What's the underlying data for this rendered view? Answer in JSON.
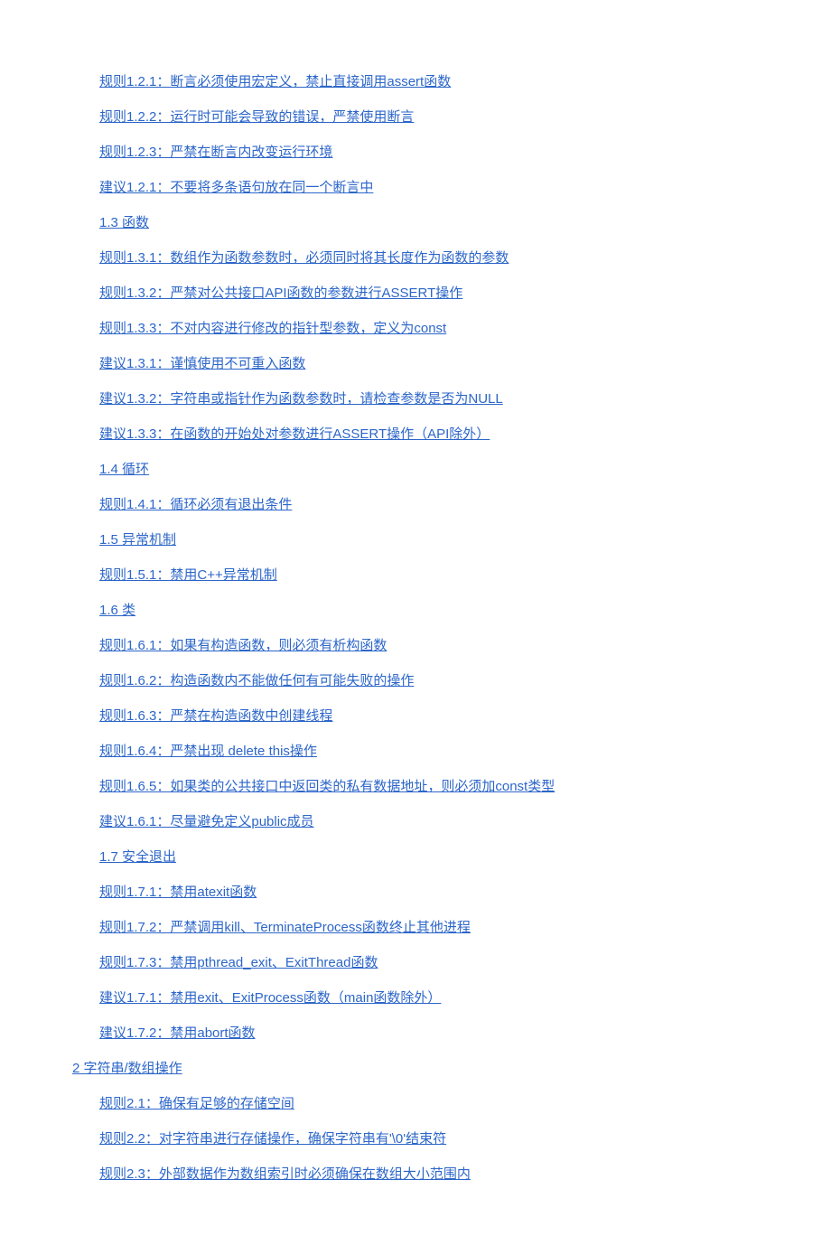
{
  "toc": [
    {
      "level": 3,
      "text": "规则1.2.1：断言必须使用宏定义，禁止直接调用assert函数"
    },
    {
      "level": 3,
      "text": "规则1.2.2：运行时可能会导致的错误，严禁使用断言"
    },
    {
      "level": 3,
      "text": "规则1.2.3：严禁在断言内改变运行环境"
    },
    {
      "level": 3,
      "text": "建议1.2.1：不要将多条语句放在同一个断言中"
    },
    {
      "level": 2,
      "text": "1.3 函数"
    },
    {
      "level": 3,
      "text": "规则1.3.1：数组作为函数参数时，必须同时将其长度作为函数的参数"
    },
    {
      "level": 3,
      "text": "规则1.3.2：严禁对公共接口API函数的参数进行ASSERT操作"
    },
    {
      "level": 3,
      "text": "规则1.3.3：不对内容进行修改的指针型参数，定义为const"
    },
    {
      "level": 3,
      "text": "建议1.3.1：谨慎使用不可重入函数"
    },
    {
      "level": 3,
      "text": "建议1.3.2：字符串或指针作为函数参数时，请检查参数是否为NULL"
    },
    {
      "level": 3,
      "text": "建议1.3.3：在函数的开始处对参数进行ASSERT操作（API除外）"
    },
    {
      "level": 2,
      "text": "1.4 循环"
    },
    {
      "level": 3,
      "text": "规则1.4.1：循环必须有退出条件"
    },
    {
      "level": 2,
      "text": "1.5 异常机制"
    },
    {
      "level": 3,
      "text": "规则1.5.1：禁用C++异常机制"
    },
    {
      "level": 2,
      "text": "1.6 类"
    },
    {
      "level": 3,
      "text": "规则1.6.1：如果有构造函数，则必须有析构函数"
    },
    {
      "level": 3,
      "text": "规则1.6.2：构造函数内不能做任何有可能失败的操作"
    },
    {
      "level": 3,
      "text": "规则1.6.3：严禁在构造函数中创建线程"
    },
    {
      "level": 3,
      "text": "规则1.6.4：严禁出现 delete this操作"
    },
    {
      "level": 3,
      "text": "规则1.6.5：如果类的公共接口中返回类的私有数据地址，则必须加const类型"
    },
    {
      "level": 3,
      "text": "建议1.6.1：尽量避免定义public成员"
    },
    {
      "level": 2,
      "text": "1.7 安全退出"
    },
    {
      "level": 3,
      "text": "规则1.7.1：禁用atexit函数"
    },
    {
      "level": 3,
      "text": "规则1.7.2：严禁调用kill、TerminateProcess函数终止其他进程"
    },
    {
      "level": 3,
      "text": "规则1.7.3：禁用pthread_exit、ExitThread函数"
    },
    {
      "level": 3,
      "text": "建议1.7.1：禁用exit、ExitProcess函数（main函数除外）"
    },
    {
      "level": 3,
      "text": "建议1.7.2：禁用abort函数"
    },
    {
      "level": 1,
      "text": "2 字符串/数组操作"
    },
    {
      "level": 3,
      "text": "规则2.1：确保有足够的存储空间"
    },
    {
      "level": 3,
      "text": "规则2.2：对字符串进行存储操作，确保字符串有'\\0'结束符"
    },
    {
      "level": 3,
      "text": "规则2.3：外部数据作为数组索引时必须确保在数组大小范围内"
    }
  ]
}
